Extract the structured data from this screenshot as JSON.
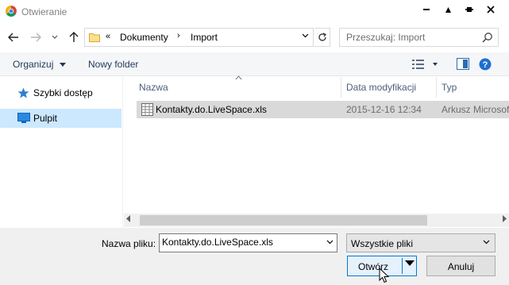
{
  "window": {
    "title": "Otwieranie",
    "app_icon": "chrome-icon",
    "controls": [
      "minimize-icon",
      "maximize-icon",
      "close-icon"
    ]
  },
  "navigation": {
    "back_icon": "arrow-left-icon",
    "forward_icon": "arrow-right-icon",
    "recent_icon": "chevron-down-icon",
    "up_icon": "arrow-up-icon",
    "address": {
      "overflow": "«",
      "segments": [
        "Dokumenty",
        "Import"
      ],
      "separator": "›"
    },
    "refresh_icon": "refresh-icon",
    "search_placeholder": "Przeszukaj: Import"
  },
  "toolbar": {
    "organize_label": "Organizuj",
    "new_folder_label": "Nowy folder",
    "view_icon": "view-details-icon",
    "preview_icon": "preview-pane-icon",
    "help_icon": "help-icon"
  },
  "sidebar": {
    "items": [
      {
        "label": "Szybki dostęp",
        "icon": "star-icon",
        "selected": false
      },
      {
        "label": "Pulpit",
        "icon": "desktop-icon",
        "selected": true
      }
    ]
  },
  "file_list": {
    "columns": [
      "Nazwa",
      "Data modyfikacji",
      "Typ"
    ],
    "rows": [
      {
        "name": "Kontakty.do.LiveSpace.xls",
        "date": "2015-12-16 12:34",
        "type": "Arkusz Microsoft",
        "icon": "spreadsheet-file-icon",
        "selected": true
      }
    ]
  },
  "footer": {
    "filename_label": "Nazwa pliku:",
    "filename_value": "Kontakty.do.LiveSpace.xls",
    "filter_value": "Wszystkie pliki",
    "open_label": "Otwórz",
    "cancel_label": "Anuluj"
  },
  "colors": {
    "selection": "#cce8ff",
    "file_selection": "#d9d9d9",
    "accent": "#0078d7",
    "toolbar_text": "#1e395b"
  }
}
